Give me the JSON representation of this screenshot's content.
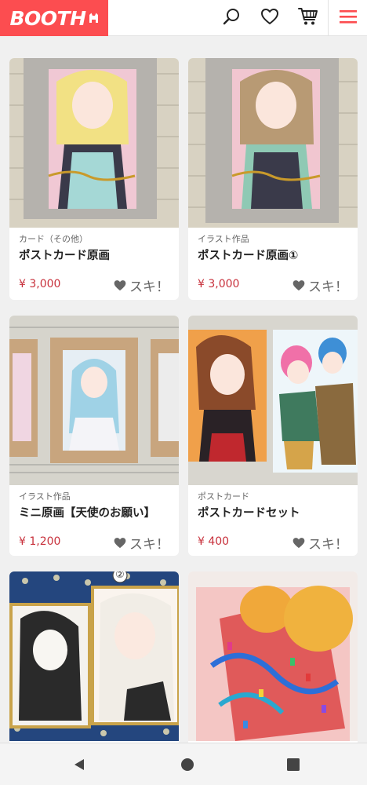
{
  "header": {
    "logo_text": "BOOTH",
    "brand_color": "#fc4d50"
  },
  "items": [
    {
      "category": "カード（その他）",
      "title": "ポストカード原画",
      "price": "¥ 3,000",
      "like_label": "スキ！"
    },
    {
      "category": "イラスト作品",
      "title": "ポストカード原画①",
      "price": "¥ 3,000",
      "like_label": "スキ！"
    },
    {
      "category": "イラスト作品",
      "title": "ミニ原画【天使のお願い】",
      "price": "¥ 1,200",
      "like_label": "スキ！"
    },
    {
      "category": "ポストカード",
      "title": "ポストカードセット",
      "price": "¥ 400",
      "like_label": "スキ！"
    },
    {
      "category": "",
      "title": "",
      "price": "",
      "like_label": ""
    },
    {
      "category": "",
      "title": "",
      "price": "",
      "like_label": ""
    }
  ],
  "thumbnails": [
    {
      "icon": "framed-artwork-blonde-girl"
    },
    {
      "icon": "framed-artwork-brunette-girl"
    },
    {
      "icon": "wooden-frames-blue-hair-girl"
    },
    {
      "icon": "postcards-bunny-girl-and-couple"
    },
    {
      "icon": "shikishi-girls-artwork",
      "badge": "②"
    },
    {
      "icon": "sealed-postcard-with-confetti"
    }
  ],
  "colors": {
    "price": "#c8313c",
    "background": "#f0f0f0"
  }
}
